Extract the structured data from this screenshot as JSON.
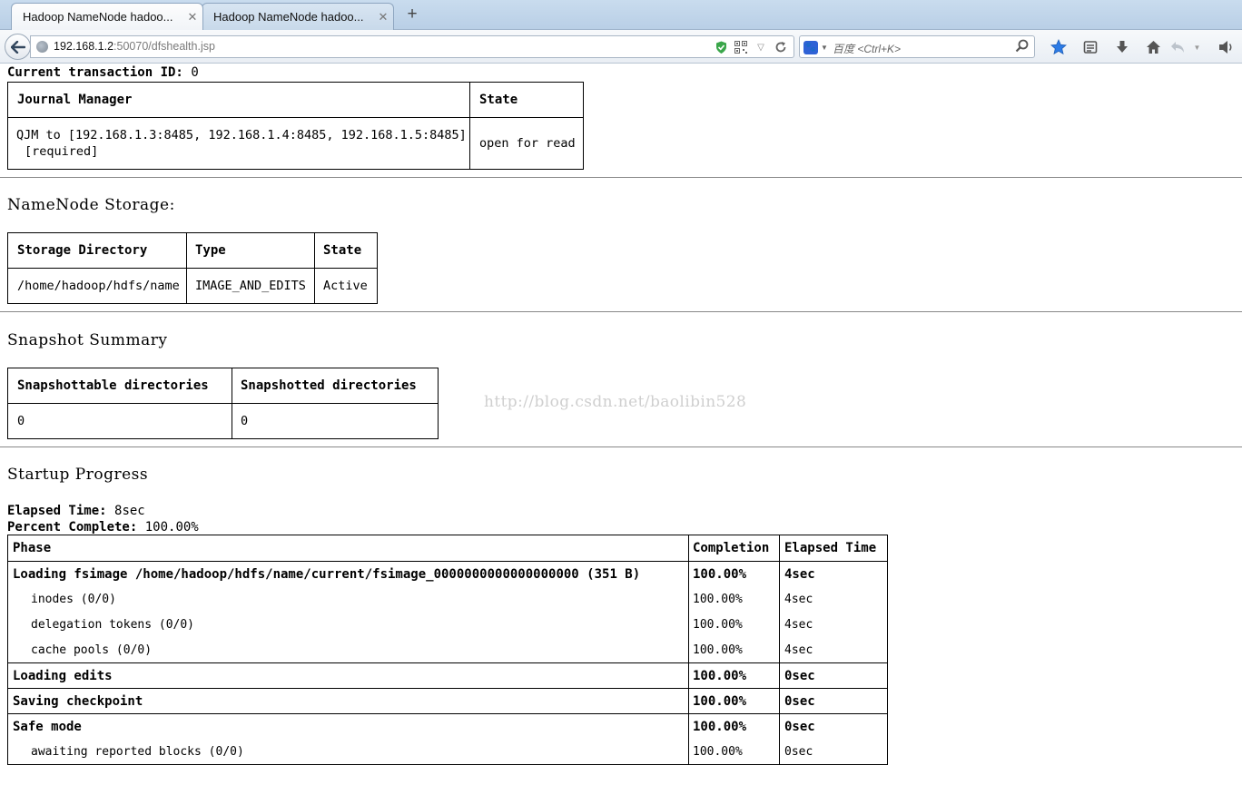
{
  "browser": {
    "tabs": [
      {
        "title": "Hadoop NameNode hadoo...",
        "active": true
      },
      {
        "title": "Hadoop NameNode hadoo...",
        "active": false
      }
    ],
    "new_tab_label": "+",
    "url_host": "192.168.1.2",
    "url_rest": ":50070/dfshealth.jsp",
    "search_placeholder": "百度 <Ctrl+K>",
    "icons": [
      "back-arrow-icon",
      "globe-icon",
      "shield-icon",
      "qr-code-icon",
      "dropdown-icon",
      "reload-icon",
      "baidu-paw-icon",
      "search-icon",
      "bookmark-star-icon",
      "reading-list-icon",
      "download-icon",
      "home-icon",
      "undo-icon",
      "speaker-icon"
    ],
    "accent_color": "#2f62d6"
  },
  "journal": {
    "transaction_label": "Current transaction ID:",
    "transaction_value": "0",
    "headers": [
      "Journal Manager",
      "State"
    ],
    "rows": [
      {
        "manager": "QJM to [192.168.1.3:8485, 192.168.1.4:8485, 192.168.1.5:8485]",
        "manager_suffix": "[required]",
        "state": "open for read"
      }
    ]
  },
  "storage": {
    "title": "NameNode Storage:",
    "headers": [
      "Storage Directory",
      "Type",
      "State"
    ],
    "rows": [
      {
        "dir": "/home/hadoop/hdfs/name",
        "type": "IMAGE_AND_EDITS",
        "state": "Active"
      }
    ]
  },
  "snapshot": {
    "title": "Snapshot Summary",
    "headers": [
      "Snapshottable directories",
      "Snapshotted directories"
    ],
    "values": [
      "0",
      "0"
    ]
  },
  "watermark": "http://blog.csdn.net/baolibin528",
  "startup": {
    "title": "Startup Progress",
    "elapsed_label": "Elapsed Time:",
    "elapsed_value": "8sec",
    "percent_label": "Percent Complete:",
    "percent_value": "100.00%",
    "headers": [
      "Phase",
      "Completion",
      "Elapsed Time"
    ],
    "phases": [
      {
        "name": "Loading fsimage /home/hadoop/hdfs/name/current/fsimage_0000000000000000000 (351 B)",
        "completion": "100.00%",
        "elapsed": "4sec",
        "steps": [
          {
            "name": "inodes (0/0)",
            "completion": "100.00%",
            "elapsed": "4sec"
          },
          {
            "name": "delegation tokens (0/0)",
            "completion": "100.00%",
            "elapsed": "4sec"
          },
          {
            "name": "cache pools (0/0)",
            "completion": "100.00%",
            "elapsed": "4sec"
          }
        ]
      },
      {
        "name": "Loading edits",
        "completion": "100.00%",
        "elapsed": "0sec",
        "steps": []
      },
      {
        "name": "Saving checkpoint",
        "completion": "100.00%",
        "elapsed": "0sec",
        "steps": []
      },
      {
        "name": "Safe mode",
        "completion": "100.00%",
        "elapsed": "0sec",
        "steps": [
          {
            "name": "awaiting reported blocks (0/0)",
            "completion": "100.00%",
            "elapsed": "0sec"
          }
        ]
      }
    ]
  }
}
